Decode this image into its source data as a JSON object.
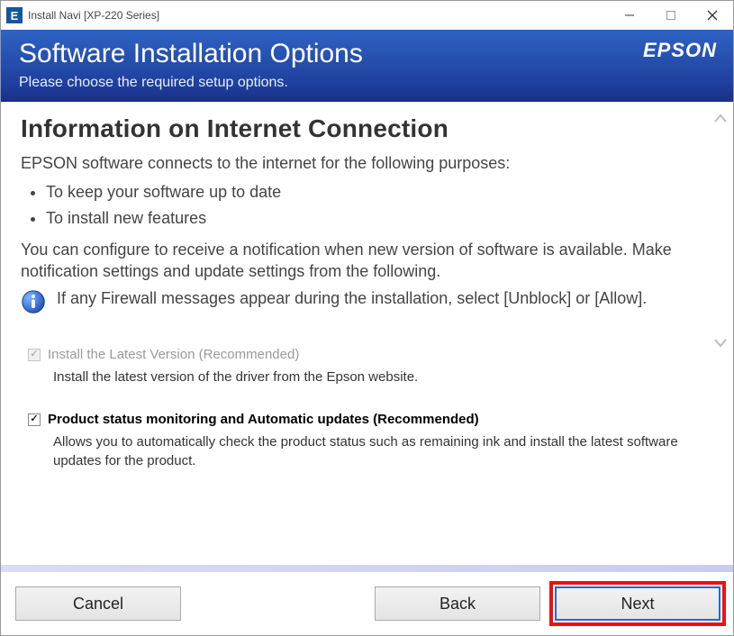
{
  "window": {
    "title": "Install Navi [XP-220 Series]"
  },
  "header": {
    "title": "Software Installation Options",
    "subtitle": "Please choose the required setup options.",
    "brand": "EPSON"
  },
  "info": {
    "section_title": "Information on Internet Connection",
    "intro": "EPSON software connects to the internet for the following purposes:",
    "purposes": [
      "To keep your software up to date",
      "To install new features"
    ],
    "configure_text": "You can configure to receive a notification when new version of software is available. Make notification settings and update settings from the following.",
    "firewall_note": "If any Firewall messages appear during the installation, select [Unblock] or [Allow]."
  },
  "options": [
    {
      "id": "install-latest",
      "label": "Install the Latest Version (Recommended)",
      "desc": "Install the latest version of the driver from the Epson website.",
      "checked": true,
      "enabled": false
    },
    {
      "id": "status-monitoring",
      "label": "Product status monitoring and Automatic updates (Recommended)",
      "desc": "Allows you to automatically check the product status such as remaining ink and install the latest software updates for the product.",
      "checked": true,
      "enabled": true
    }
  ],
  "buttons": {
    "cancel": "Cancel",
    "back": "Back",
    "next": "Next"
  }
}
